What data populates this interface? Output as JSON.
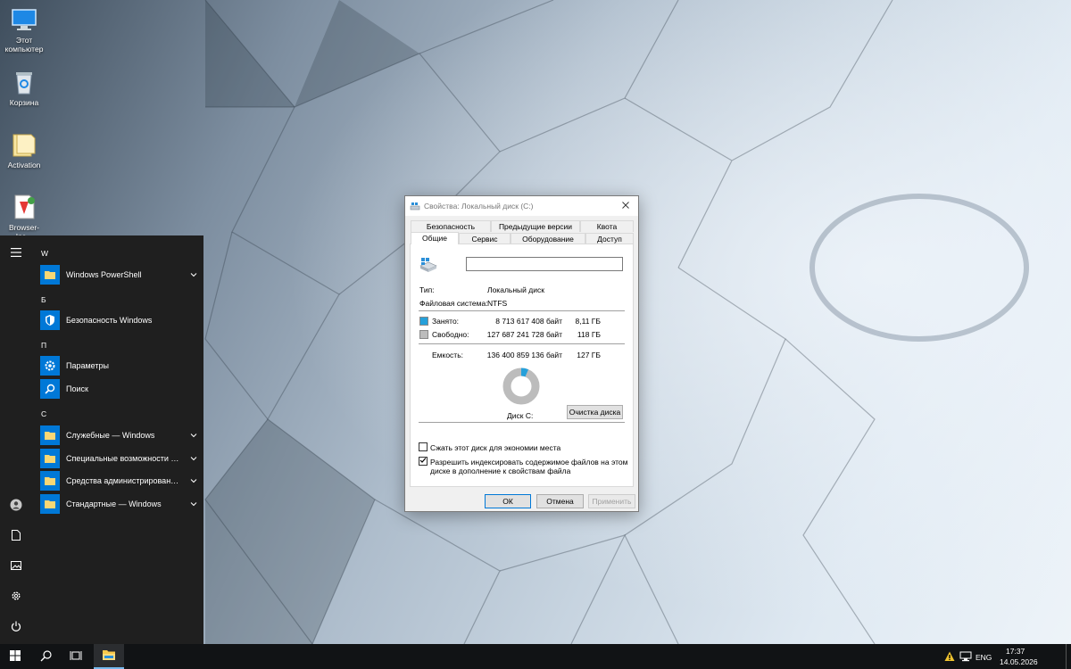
{
  "desktop": {
    "icons": [
      {
        "label": "Этот компьютер",
        "icon": "monitor-icon"
      },
      {
        "label": "Корзина",
        "icon": "recycle-bin-icon"
      },
      {
        "label": "Activation",
        "icon": "folder-icon"
      },
      {
        "label": "Browser-Ins...",
        "icon": "file-icon"
      }
    ]
  },
  "start_menu": {
    "rail": {
      "menu_icon": "hamburger-icon",
      "user_icon": "user-icon",
      "documents_icon": "document-icon",
      "pictures_icon": "picture-icon",
      "settings_icon": "gear-icon",
      "power_icon": "power-icon"
    },
    "groups": [
      {
        "letter": "W",
        "items": [
          {
            "label": "Windows PowerShell",
            "expandable": true,
            "icon": "folder-icon"
          }
        ]
      },
      {
        "letter": "Б",
        "items": [
          {
            "label": "Безопасность Windows",
            "expandable": false,
            "icon": "shield-icon"
          }
        ]
      },
      {
        "letter": "П",
        "items": [
          {
            "label": "Параметры",
            "expandable": false,
            "icon": "gear-icon"
          },
          {
            "label": "Поиск",
            "expandable": false,
            "icon": "search-icon"
          }
        ]
      },
      {
        "letter": "С",
        "items": [
          {
            "label": "Служебные — Windows",
            "expandable": true,
            "icon": "folder-icon"
          },
          {
            "label": "Специальные возможности Wi...",
            "expandable": true,
            "icon": "folder-icon"
          },
          {
            "label": "Средства администрирования...",
            "expandable": true,
            "icon": "folder-icon"
          },
          {
            "label": "Стандартные — Windows",
            "expandable": true,
            "icon": "folder-icon"
          }
        ]
      }
    ]
  },
  "dialog": {
    "title": "Свойства: Локальный диск (C:)",
    "tabs_row1": [
      "Безопасность",
      "Предыдущие версии",
      "Квота"
    ],
    "tabs_row2": [
      "Общие",
      "Сервис",
      "Оборудование",
      "Доступ"
    ],
    "active_tab": "Общие",
    "drive_name_value": "",
    "type_label": "Тип:",
    "type_value": "Локальный диск",
    "fs_label": "Файловая система:",
    "fs_value": "NTFS",
    "used_label": "Занято:",
    "used_bytes": "8 713 617 408 байт",
    "used_short": "8,11 ГБ",
    "free_label": "Свободно:",
    "free_bytes": "127 687 241 728 байт",
    "free_short": "118 ГБ",
    "capacity_label": "Емкость:",
    "capacity_bytes": "136 400 859 136 байт",
    "capacity_short": "127 ГБ",
    "used_fraction": 0.0639,
    "used_color": "#26a0da",
    "free_color": "#bcbcbc",
    "drive_label": "Диск С:",
    "cleanup_button": "Очистка диска",
    "compress_label": "Сжать этот диск для экономии места",
    "compress_checked": false,
    "index_label_line1": "Разрешить индексировать содержимое файлов на этом",
    "index_label_line2": "диске в дополнение к свойствам файла",
    "index_checked": true,
    "ok_button": "ОК",
    "cancel_button": "Отмена",
    "apply_button": "Применить"
  },
  "taskbar": {
    "start_icon": "windows-logo-icon",
    "search_icon": "search-icon",
    "task_view_icon": "task-view-icon",
    "explorer_icon": "folder-icon",
    "language": "ENG",
    "time": "17:37",
    "date": "14.05.2026"
  }
}
